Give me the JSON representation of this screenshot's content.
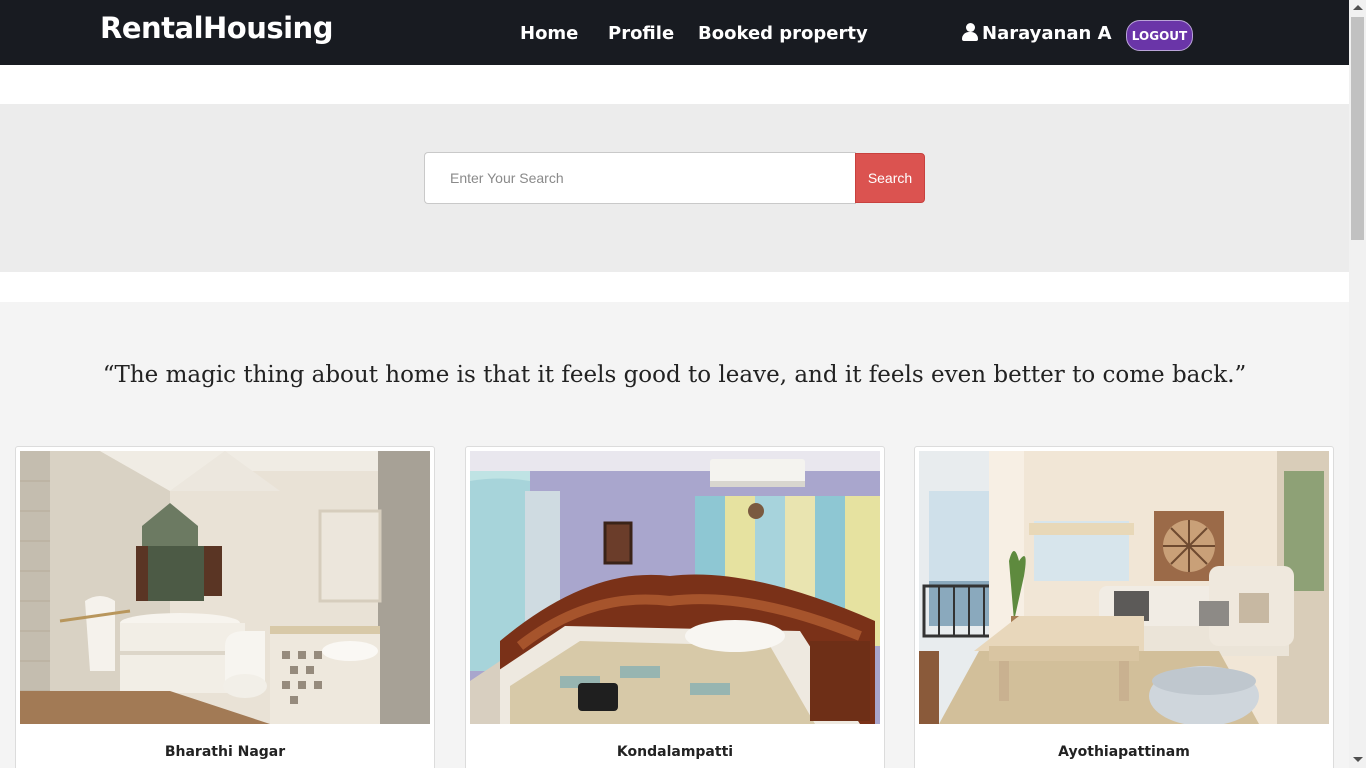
{
  "navbar": {
    "brand": "RentalHousing",
    "links": [
      "Home",
      "Profile",
      "Booked property"
    ],
    "user_name": "Narayanan A",
    "logout_label": "LOGOUT",
    "background": "#181b21",
    "logout_color": "#6a35a8"
  },
  "search": {
    "placeholder": "Enter Your Search",
    "value": "",
    "button_label": "Search",
    "button_color": "#db5350"
  },
  "quote": "“The magic thing about home is that it feels good to leave, and it feels even better to come back.”",
  "properties": [
    {
      "name": "Bharathi Nagar",
      "image": "bathroom"
    },
    {
      "name": "Kondalampatti",
      "image": "bedroom"
    },
    {
      "name": "Ayothiapattinam",
      "image": "living-room"
    }
  ]
}
